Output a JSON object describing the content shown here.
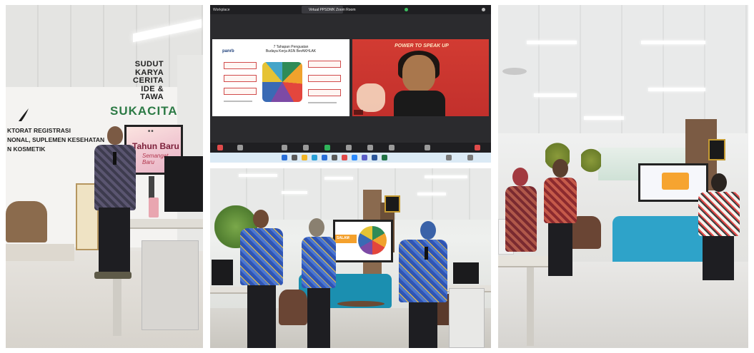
{
  "panel_1": {
    "wall_sign_top": "SUDUT\nKARYA\nCERITA\nIDE &\nTAWA",
    "wall_sign_main": "SUKACITA",
    "wall_sign_left": "KTORAT REGISTRASI\nNONAL, SUPLEMEN KESEHATAN\nN KOSMETIK",
    "tv_title": "Tahun Baru",
    "tv_subtitle": "Semangat Baru"
  },
  "panel_2": {
    "app_label": "Workplace",
    "tab_label": "Virtual PPSDMK Zoom Room",
    "slide_title": "7 Tahapan Penguatan\nBudaya Kerja ASN BerAKHLAK",
    "slide_brand": "panrb",
    "video_banner": "POWER TO SPEAK UP",
    "colors": {
      "background": "#2b2b2e",
      "video_bg": "#d23b32"
    }
  },
  "panel_3": {
    "screen_banner": "SALAM"
  },
  "panel_4": {}
}
